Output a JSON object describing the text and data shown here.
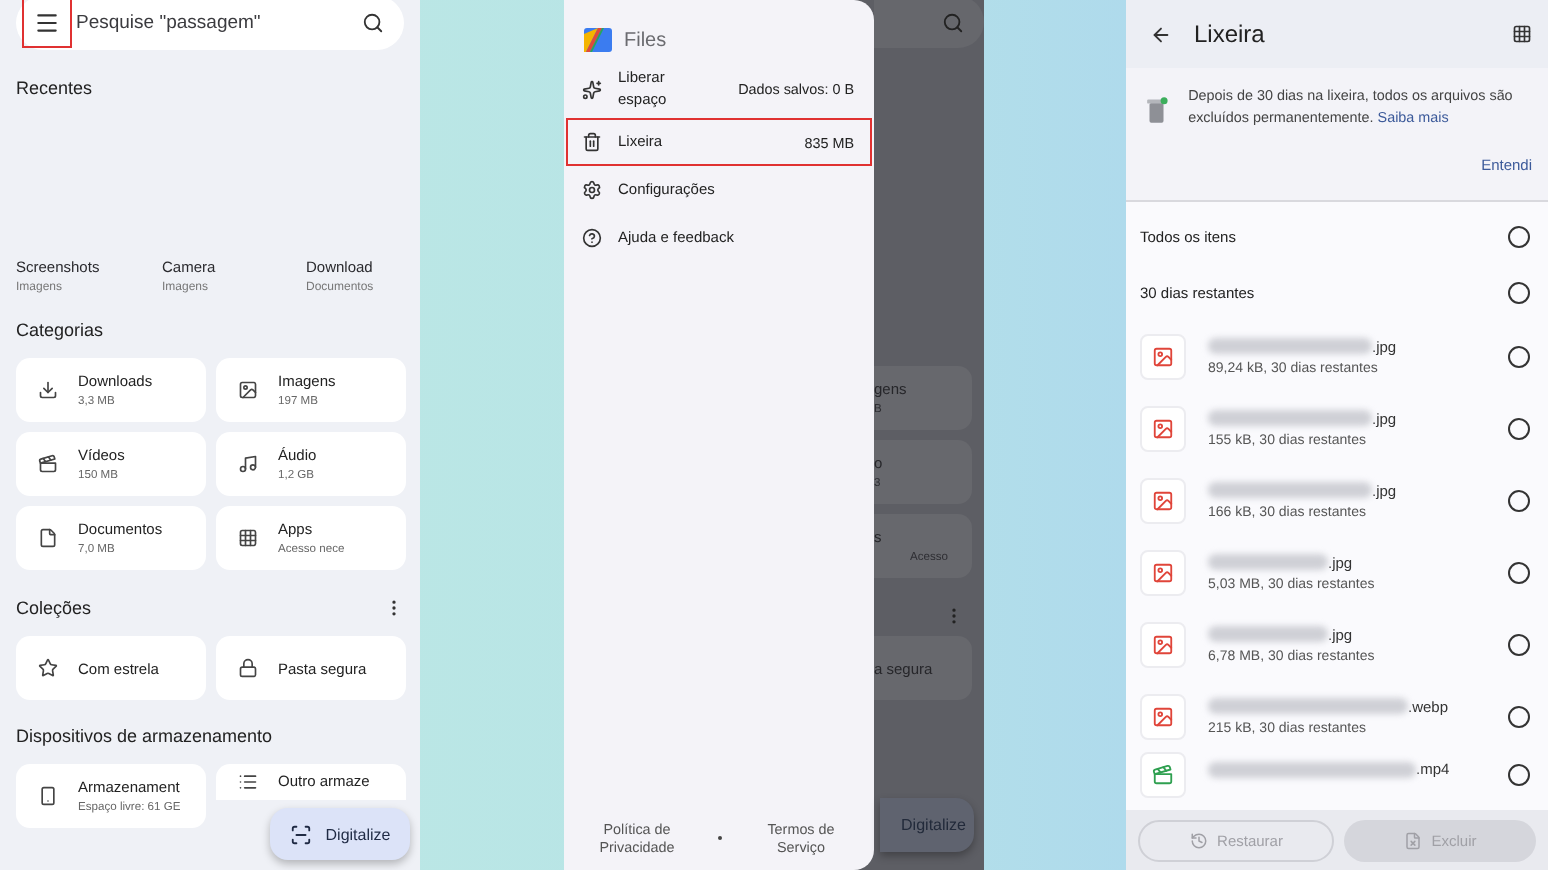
{
  "left_screen": {
    "search": {
      "placeholder": "Pesquise \"passagem\"",
      "menu_highlighted": true
    },
    "recents": {
      "title": "Recentes",
      "folders": [
        {
          "name": "Screenshots",
          "type": "Imagens"
        },
        {
          "name": "Camera",
          "type": "Imagens"
        },
        {
          "name": "Download",
          "type": "Documentos"
        }
      ]
    },
    "categories": {
      "title": "Categorias",
      "items": [
        {
          "kind": "download",
          "name": "Downloads",
          "detail": "3,3 MB"
        },
        {
          "kind": "image",
          "name": "Imagens",
          "detail": "197 MB"
        },
        {
          "kind": "video",
          "name": "Vídeos",
          "detail": "150 MB"
        },
        {
          "kind": "audio",
          "name": "Áudio",
          "detail": "1,2 GB"
        },
        {
          "kind": "document",
          "name": "Documentos",
          "detail": "7,0 MB"
        },
        {
          "kind": "apps",
          "name": "Apps",
          "detail": "Acesso nece"
        }
      ]
    },
    "collections": {
      "title": "Coleções",
      "items": [
        {
          "kind": "star",
          "name": "Com estrela"
        },
        {
          "kind": "lock",
          "name": "Pasta segura"
        }
      ]
    },
    "storage": {
      "title": "Dispositivos de armazenamento",
      "items": [
        {
          "kind": "phone",
          "name": "Armazenament",
          "detail": "Espaço livre: 61 GE"
        },
        {
          "kind": "list",
          "name": "Outro armaze"
        }
      ]
    },
    "fab": "Digitalize"
  },
  "middle_screen": {
    "app_name": "Files",
    "menu": [
      {
        "kind": "sparkle",
        "label": "Liberar espaço",
        "detail": "Dados salvos: 0 B",
        "highlighted": false
      },
      {
        "kind": "trash",
        "label": "Lixeira",
        "detail": "835 MB",
        "highlighted": true
      },
      {
        "kind": "gear",
        "label": "Configurações",
        "highlighted": false
      },
      {
        "kind": "help",
        "label": "Ajuda e feedback",
        "highlighted": false
      }
    ],
    "footer_links": [
      "Política de Privacidade",
      "Termos de Serviço"
    ],
    "behind": {
      "cards": [
        {
          "title": "gens",
          "detail": "B"
        },
        {
          "title": "o",
          "detail": "3"
        },
        {
          "title": "s",
          "detail": "Acesso"
        }
      ],
      "collection": "a segura",
      "fab": "Digitalize"
    }
  },
  "right_screen": {
    "title": "Lixeira",
    "notice": {
      "text": "Depois de 30 dias na lixeira, todos os arquivos são excluídos permanentemente.",
      "link": "Saiba mais",
      "dismiss": "Entendi"
    },
    "groups": [
      {
        "label": "Todos os itens",
        "selected": false
      },
      {
        "label": "30 dias restantes",
        "selected": false
      }
    ],
    "files": [
      {
        "kind": "image",
        "name": ".jpg",
        "detail": "89,24 kB, 30 dias restantes",
        "selected": false
      },
      {
        "kind": "image",
        "name": ".jpg",
        "detail": "155 kB, 30 dias restantes",
        "selected": false
      },
      {
        "kind": "image",
        "name": ".jpg",
        "detail": "166 kB, 30 dias restantes",
        "selected": false
      },
      {
        "kind": "image",
        "name": ".jpg",
        "detail": "5,03 MB, 30 dias restantes",
        "selected": false
      },
      {
        "kind": "image",
        "name": ".jpg",
        "detail": "6,78 MB, 30 dias restantes",
        "selected": false
      },
      {
        "kind": "image",
        "name": ".webp",
        "detail": "215 kB, 30 dias restantes",
        "selected": false
      },
      {
        "kind": "video",
        "name": ".mp4",
        "selected": false
      }
    ],
    "actions": [
      {
        "kind": "restore",
        "label": "Restaurar",
        "disabled": true
      },
      {
        "kind": "delete",
        "label": "Excluir",
        "disabled": true
      }
    ]
  }
}
